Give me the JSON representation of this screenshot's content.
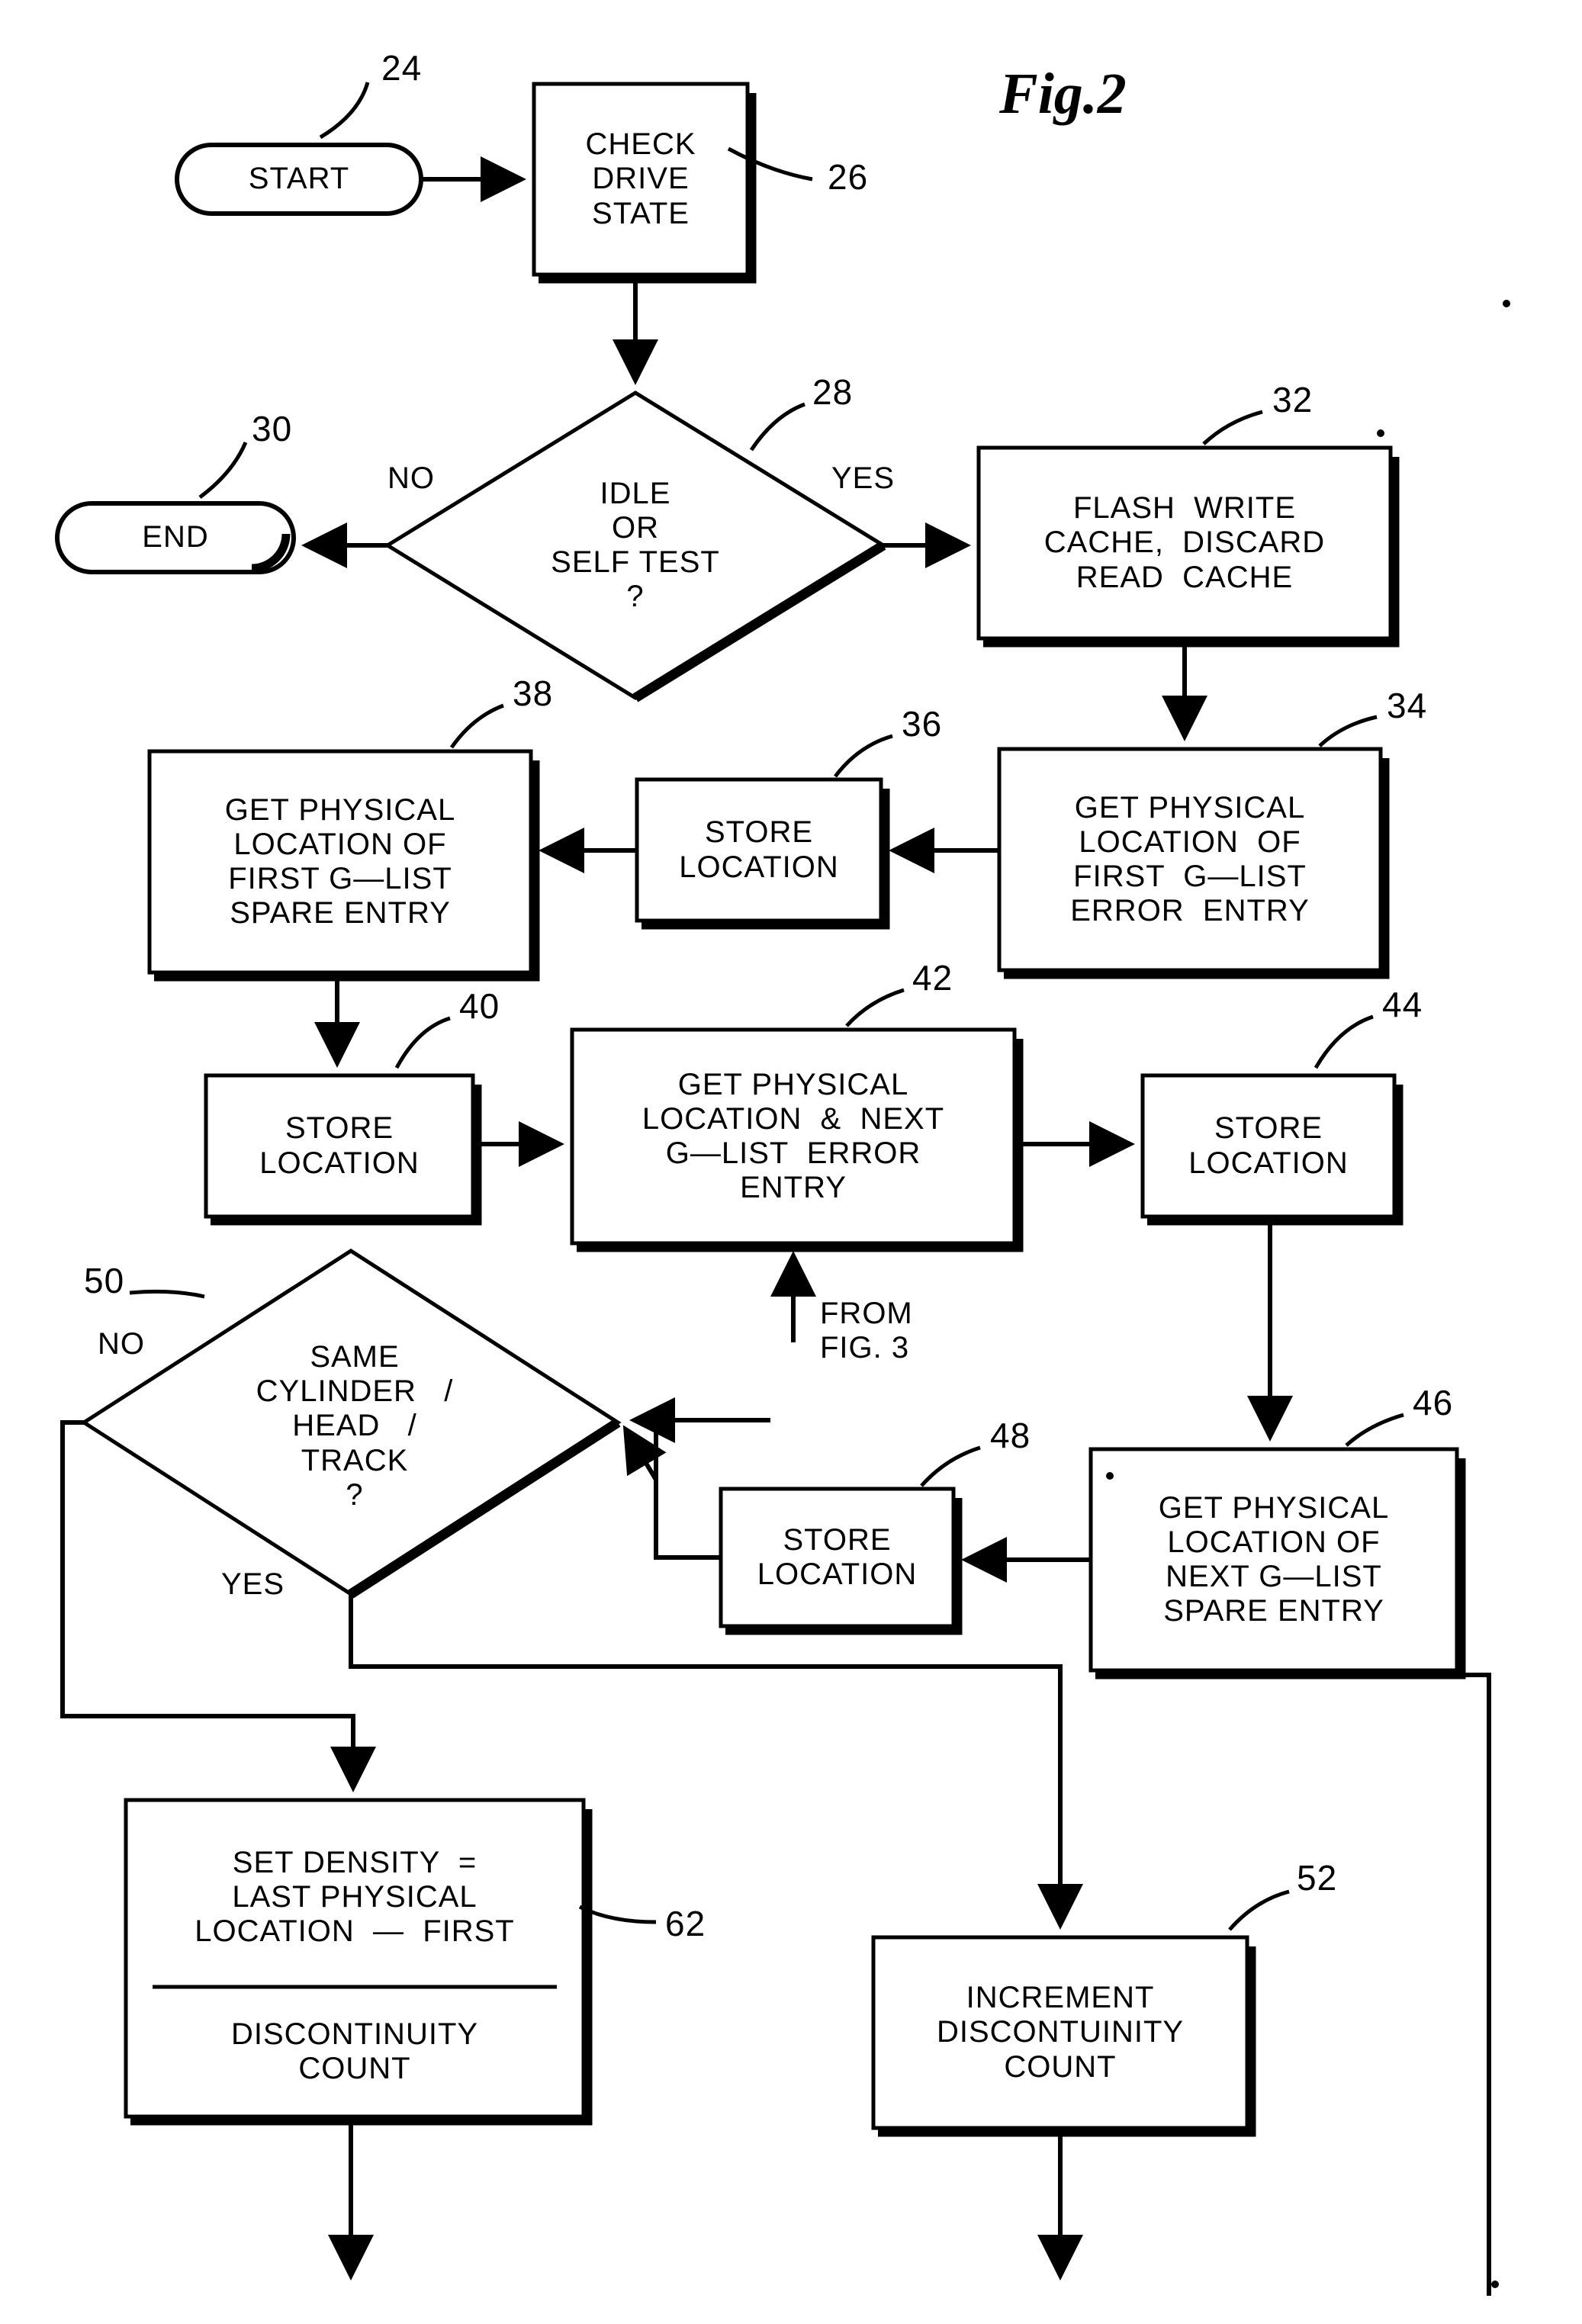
{
  "figure": {
    "title": "Fig.2",
    "type": "flowchart"
  },
  "nodes": {
    "start": {
      "label": "START",
      "ref": "24"
    },
    "check_drive_state": {
      "lines": [
        "CHECK",
        "DRIVE",
        "STATE"
      ],
      "ref": "26"
    },
    "idle_or_self_test": {
      "lines": [
        "IDLE",
        "OR",
        "SELF TEST",
        "?"
      ],
      "ref": "28"
    },
    "end": {
      "label": "END",
      "ref": "30"
    },
    "flash_write_cache": {
      "lines": [
        "FLASH  WRITE",
        "CACHE,  DISCARD",
        "READ  CACHE"
      ],
      "ref": "32"
    },
    "get_first_error": {
      "lines": [
        "GET PHYSICAL",
        "LOCATION  OF",
        "FIRST  G—LIST",
        "ERROR  ENTRY"
      ],
      "ref": "34"
    },
    "store_location_36": {
      "lines": [
        "STORE",
        "LOCATION"
      ],
      "ref": "36"
    },
    "get_first_spare": {
      "lines": [
        "GET PHYSICAL",
        "LOCATION OF",
        "FIRST G—LIST",
        "SPARE ENTRY"
      ],
      "ref": "38"
    },
    "store_location_40": {
      "lines": [
        "STORE",
        "LOCATION"
      ],
      "ref": "40"
    },
    "get_next_error": {
      "lines": [
        "GET PHYSICAL",
        "LOCATION  &  NEXT",
        "G—LIST  ERROR",
        "ENTRY"
      ],
      "ref": "42"
    },
    "store_location_44": {
      "lines": [
        "STORE",
        "LOCATION"
      ],
      "ref": "44"
    },
    "get_next_spare": {
      "lines": [
        "GET PHYSICAL",
        "LOCATION OF",
        "NEXT G—LIST",
        "SPARE ENTRY"
      ],
      "ref": "46"
    },
    "store_location_48": {
      "lines": [
        "STORE",
        "LOCATION"
      ],
      "ref": "48"
    },
    "same_cyl_head_track": {
      "lines": [
        "SAME",
        "CYLINDER   /",
        "HEAD   /",
        "TRACK",
        "?"
      ],
      "ref": "50"
    },
    "increment_discontinuity": {
      "lines": [
        "INCREMENT",
        "DISCONTUINITY",
        "COUNT"
      ],
      "ref": "52"
    },
    "set_density": {
      "lines_top": [
        "SET DENSITY  =",
        "LAST PHYSICAL",
        "LOCATION  —  FIRST"
      ],
      "lines_bottom": [
        "DISCONTINUITY",
        "COUNT"
      ],
      "ref": "62"
    }
  },
  "edge_labels": {
    "no_from_idle": "NO",
    "yes_from_idle": "YES",
    "no_from_same": "NO",
    "yes_from_same": "YES",
    "from_fig3": [
      "FROM",
      "FIG. 3"
    ]
  }
}
